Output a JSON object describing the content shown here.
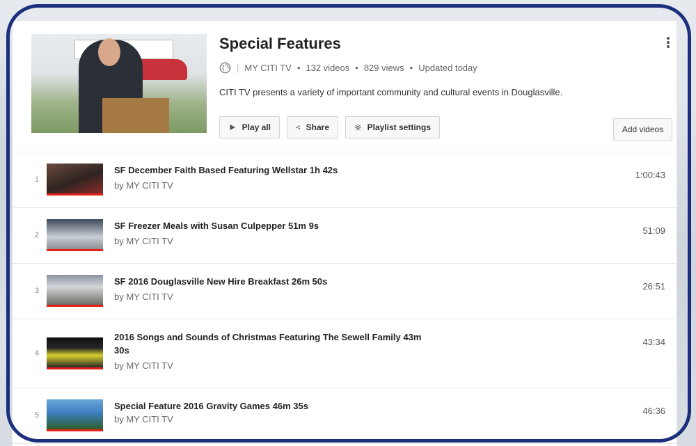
{
  "playlist": {
    "title": "Special Features",
    "channel": "MY CITI TV",
    "video_count": "132 videos",
    "views": "829 views",
    "updated": "Updated today",
    "description": "CITI TV presents a variety of important community and cultural events in Douglasville.",
    "dot": "•",
    "separator": "|"
  },
  "buttons": {
    "play_all": "Play all",
    "share": "Share",
    "playlist_settings": "Playlist settings",
    "add_videos": "Add videos"
  },
  "videos": [
    {
      "index": "1",
      "title": "SF December Faith Based Featuring Wellstar 1h 42s",
      "by": "by MY CITI TV",
      "duration": "1:00:43"
    },
    {
      "index": "2",
      "title": "SF Freezer Meals with Susan Culpepper 51m 9s",
      "by": "by MY CITI TV",
      "duration": "51:09"
    },
    {
      "index": "3",
      "title": "SF 2016 Douglasville New Hire Breakfast 26m 50s",
      "by": "by MY CITI TV",
      "duration": "26:51"
    },
    {
      "index": "4",
      "title": "2016 Songs and Sounds of Christmas Featuring The Sewell Family 43m 30s",
      "by": "by MY CITI TV",
      "duration": "43:34"
    },
    {
      "index": "5",
      "title": "Special Feature 2016 Gravity Games 46m 35s",
      "by": "by MY CITI TV",
      "duration": "46:36"
    }
  ],
  "colors": {
    "frame": "#1c2f7c",
    "progress": "#e62117"
  },
  "icons": {
    "privacy": "globe-icon",
    "play": "play-icon",
    "share": "share-icon",
    "settings": "gear-icon",
    "more": "more-vertical-icon"
  }
}
